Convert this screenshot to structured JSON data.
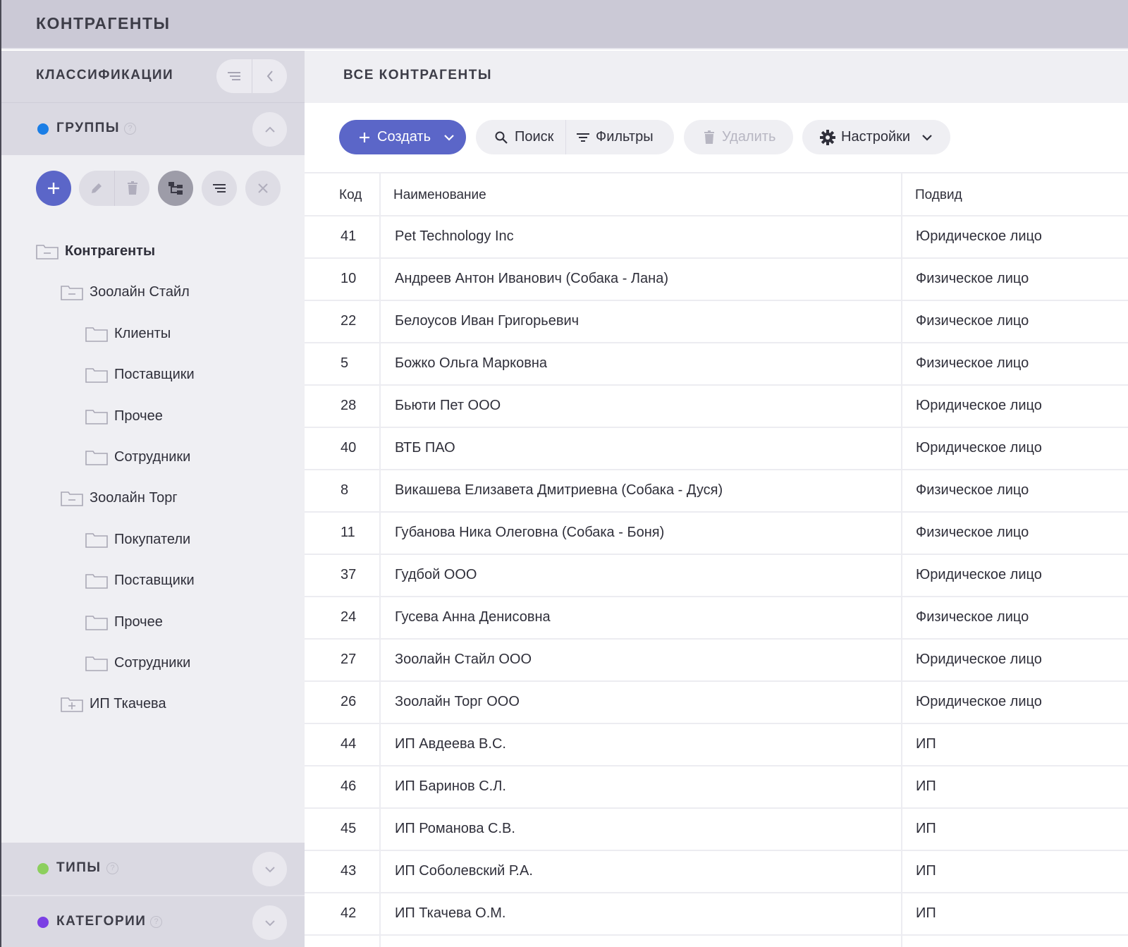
{
  "app": {
    "title": "КОНТРАГЕНТЫ"
  },
  "sidebar": {
    "header": "КЛАССИФИКАЦИИ",
    "groups": {
      "label": "ГРУППЫ",
      "help": "?",
      "color": "#1a7ee6"
    },
    "types": {
      "label": "ТИПЫ",
      "help": "?",
      "color": "#8ccf5d"
    },
    "categories": {
      "label": "КАТЕГОРИИ",
      "help": "?",
      "color": "#7b3fe4"
    },
    "tree": [
      {
        "label": "Контрагенты",
        "level": 0,
        "icon": "folder-minus-icon",
        "bold": true
      },
      {
        "label": "Зоолайн Стайл",
        "level": 1,
        "icon": "folder-minus-icon"
      },
      {
        "label": "Клиенты",
        "level": 2,
        "icon": "folder-icon"
      },
      {
        "label": "Поставщики",
        "level": 2,
        "icon": "folder-icon"
      },
      {
        "label": "Прочее",
        "level": 2,
        "icon": "folder-icon"
      },
      {
        "label": "Сотрудники",
        "level": 2,
        "icon": "folder-icon"
      },
      {
        "label": "Зоолайн Торг",
        "level": 1,
        "icon": "folder-minus-icon"
      },
      {
        "label": "Покупатели",
        "level": 2,
        "icon": "folder-icon"
      },
      {
        "label": "Поставщики",
        "level": 2,
        "icon": "folder-icon"
      },
      {
        "label": "Прочее",
        "level": 2,
        "icon": "folder-icon"
      },
      {
        "label": "Сотрудники",
        "level": 2,
        "icon": "folder-icon"
      },
      {
        "label": "ИП Ткачева",
        "level": 1,
        "icon": "folder-plus-icon"
      }
    ]
  },
  "main": {
    "title": "ВСЕ КОНТРАГЕНТЫ",
    "toolbar": {
      "create": "Создать",
      "search": "Поиск",
      "filters": "Фильтры",
      "delete": "Удалить",
      "settings": "Настройки"
    },
    "columns": [
      "Код",
      "Наименование",
      "Подвид"
    ],
    "rows": [
      {
        "code": "41",
        "name": "Pet Technology Inc",
        "subtype": "Юридическое лицо"
      },
      {
        "code": "10",
        "name": "Андреев Антон Иванович (Собака - Лана)",
        "subtype": "Физическое лицо"
      },
      {
        "code": "22",
        "name": "Белоусов Иван Григорьевич",
        "subtype": "Физическое лицо"
      },
      {
        "code": "5",
        "name": "Божко Ольга Марковна",
        "subtype": "Физическое лицо"
      },
      {
        "code": "28",
        "name": "Бьюти Пет ООО",
        "subtype": "Юридическое лицо"
      },
      {
        "code": "40",
        "name": "ВТБ ПАО",
        "subtype": "Юридическое лицо"
      },
      {
        "code": "8",
        "name": "Викашева Елизавета Дмитриевна (Собака - Дуся)",
        "subtype": "Физическое лицо"
      },
      {
        "code": "11",
        "name": "Губанова Ника Олеговна (Собака - Боня)",
        "subtype": "Физическое лицо"
      },
      {
        "code": "37",
        "name": "Гудбой ООО",
        "subtype": "Юридическое лицо"
      },
      {
        "code": "24",
        "name": "Гусева Анна Денисовна",
        "subtype": "Физическое лицо"
      },
      {
        "code": "27",
        "name": "Зоолайн Стайл ООО",
        "subtype": "Юридическое лицо"
      },
      {
        "code": "26",
        "name": "Зоолайн Торг ООО",
        "subtype": "Юридическое лицо"
      },
      {
        "code": "44",
        "name": "ИП Авдеева В.С.",
        "subtype": "ИП"
      },
      {
        "code": "46",
        "name": "ИП Баринов С.Л.",
        "subtype": "ИП"
      },
      {
        "code": "45",
        "name": "ИП Романова С.В.",
        "subtype": "ИП"
      },
      {
        "code": "43",
        "name": "ИП Соболевский Р.А.",
        "subtype": "ИП"
      },
      {
        "code": "42",
        "name": "ИП Ткачева О.М.",
        "subtype": "ИП"
      }
    ]
  }
}
